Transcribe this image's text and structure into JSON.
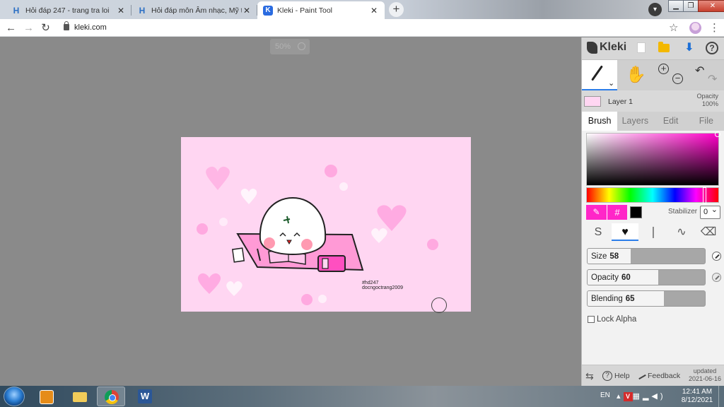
{
  "browser": {
    "tabs": [
      {
        "title": "Hỏi đáp 247 - trang tra loi",
        "active": false
      },
      {
        "title": "Hỏi đáp môn Âm nhạc, Mỹ thuật",
        "active": false
      },
      {
        "title": "Kleki - Paint Tool",
        "active": true
      }
    ],
    "tab_close": "✕",
    "new_tab": "+",
    "url": "kleki.com",
    "window_controls": {
      "minimize": "▁",
      "maximize": "❐",
      "close": "✕"
    }
  },
  "canvas": {
    "zoom": "50%",
    "drawing_text_line1": "#hd247",
    "drawing_text_line2": "docngoctrang2009"
  },
  "panel": {
    "logo": "Kleki",
    "layer": {
      "name": "Layer 1",
      "opacity_label": "Opacity",
      "opacity_value": "100%"
    },
    "tabs": [
      "Brush",
      "Layers",
      "Edit",
      "File"
    ],
    "active_tab": "Brush",
    "color": {
      "primary": "#ff26c8",
      "secondary": "#000000",
      "hex_symbol": "#"
    },
    "stabilizer": {
      "label": "Stabilizer",
      "value": "0"
    },
    "sliders": [
      {
        "label": "Size",
        "value": "58",
        "fraction": 0.37
      },
      {
        "label": "Opacity",
        "value": "60",
        "fraction": 0.6
      },
      {
        "label": "Blending",
        "value": "65",
        "fraction": 0.65
      }
    ],
    "lock_alpha": "Lock Alpha",
    "footer": {
      "help": "Help",
      "feedback": "Feedback",
      "updated_label": "updated",
      "updated_date": "2021-06-16"
    }
  },
  "taskbar": {
    "language": "EN",
    "time": "12:41 AM",
    "date": "8/12/2021"
  }
}
